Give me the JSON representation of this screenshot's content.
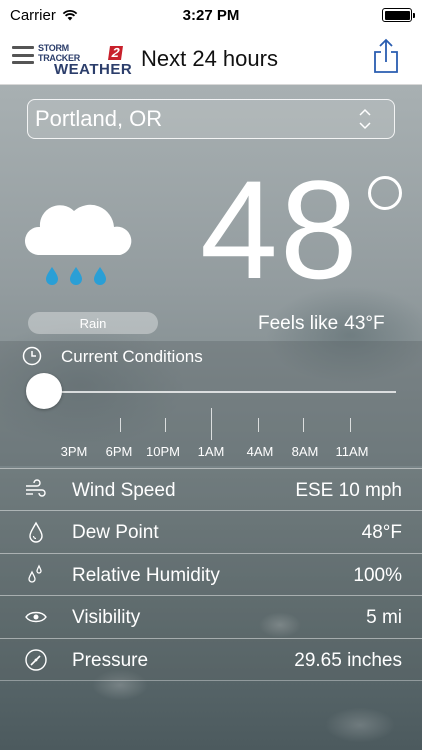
{
  "status_bar": {
    "carrier": "Carrier",
    "time": "3:27 PM"
  },
  "nav": {
    "title": "Next 24 hours",
    "logo_top": "STORM TRACKER",
    "logo_number": "2",
    "logo_bottom": "WEATHER"
  },
  "location": {
    "name": "Portland, OR"
  },
  "current": {
    "condition": "Rain",
    "condition_icon": "rain-cloud-icon",
    "temperature": "48",
    "feels_like_label": "Feels like",
    "feels_like_value": "43°F"
  },
  "timeline": {
    "label": "Current Conditions",
    "ticks": [
      "3PM",
      "6PM",
      "10PM",
      "1AM",
      "4AM",
      "8AM",
      "11AM"
    ],
    "position": 0
  },
  "metrics": [
    {
      "icon": "wind-icon",
      "label": "Wind Speed",
      "value": "ESE 10 mph"
    },
    {
      "icon": "droplet-icon",
      "label": "Dew Point",
      "value": "48°F"
    },
    {
      "icon": "humidity-drops-icon",
      "label": "Relative Humidity",
      "value": "100%"
    },
    {
      "icon": "eye-icon",
      "label": "Visibility",
      "value": "5 mi"
    },
    {
      "icon": "barometer-icon",
      "label": "Pressure",
      "value": "29.65 inches"
    }
  ],
  "colors": {
    "accent": "#2a5db0",
    "rain_drop": "#2a9fd6",
    "logo_red": "#c8202b",
    "logo_navy": "#2c3e6b"
  }
}
